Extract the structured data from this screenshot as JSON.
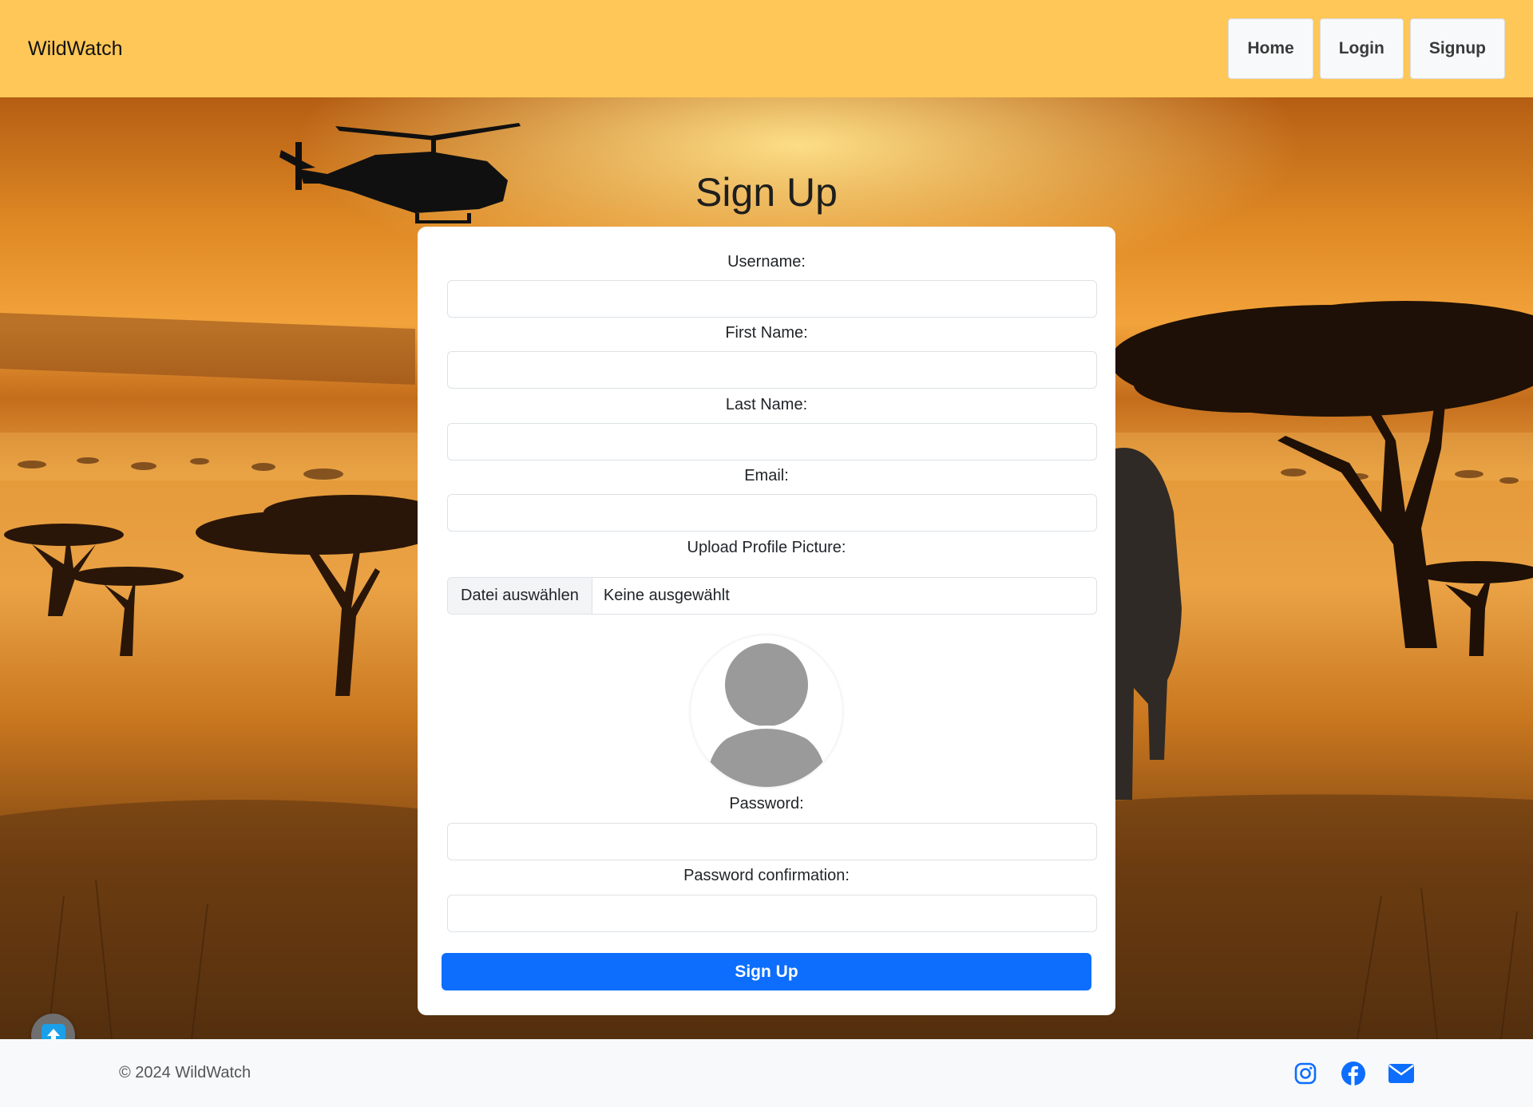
{
  "header": {
    "brand": "WildWatch",
    "nav": [
      {
        "label": "Home"
      },
      {
        "label": "Login"
      },
      {
        "label": "Signup"
      }
    ]
  },
  "form": {
    "title": "Sign Up",
    "fields": {
      "username": {
        "label": "Username:",
        "value": ""
      },
      "first_name": {
        "label": "First Name:",
        "value": ""
      },
      "last_name": {
        "label": "Last Name:",
        "value": ""
      },
      "email": {
        "label": "Email:",
        "value": ""
      },
      "profile_picture": {
        "label": "Upload Profile Picture:",
        "button": "Datei auswählen",
        "status": "Keine ausgewählt"
      },
      "password": {
        "label": "Password:",
        "value": ""
      },
      "password_confirmation": {
        "label": "Password confirmation:",
        "value": ""
      }
    },
    "submit_label": "Sign Up"
  },
  "footer": {
    "copyright": "© 2024 WildWatch",
    "socials": [
      "instagram-icon",
      "facebook-icon",
      "envelope-icon"
    ]
  },
  "colors": {
    "header_bg": "#ffc757",
    "primary": "#0d6efd",
    "social_icon": "#0d6efd",
    "footer_bg": "#f8f9fa"
  }
}
